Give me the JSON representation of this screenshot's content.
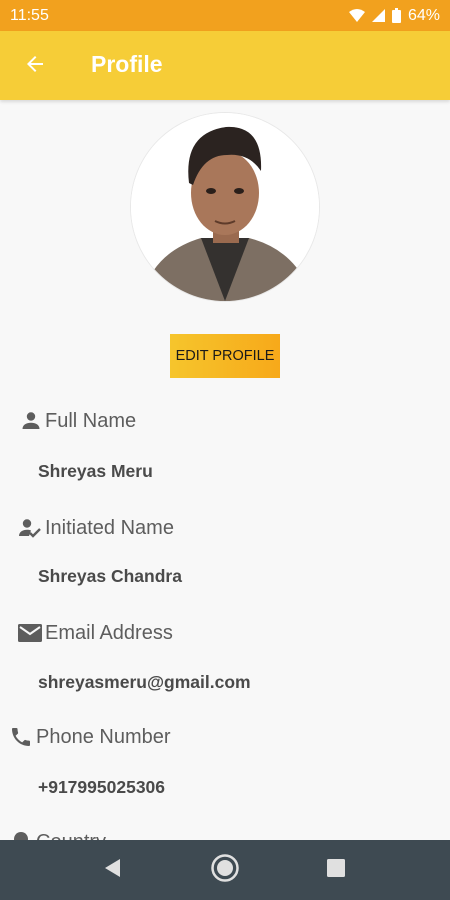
{
  "status_bar": {
    "time": "11:55",
    "battery": "64%"
  },
  "app_bar": {
    "title": "Profile",
    "back_icon": "arrow-left-icon"
  },
  "profile": {
    "edit_button_label": "EDIT PROFILE",
    "fields": [
      {
        "icon": "person-icon",
        "label": "Full Name",
        "value": "Shreyas Meru"
      },
      {
        "icon": "person-check-icon",
        "label": "Initiated Name",
        "value": "Shreyas Chandra"
      },
      {
        "icon": "email-icon",
        "label": "Email Address",
        "value": "shreyasmeru@gmail.com"
      },
      {
        "icon": "phone-icon",
        "label": "Phone Number",
        "value": "+917995025306"
      }
    ],
    "partial_next_label": "Country"
  },
  "colors": {
    "status_bar": "#f2a11e",
    "app_bar": "#f6cd37",
    "button_start": "#f6c52c",
    "button_end": "#f7a91a",
    "nav_bar": "#3e4a52"
  }
}
